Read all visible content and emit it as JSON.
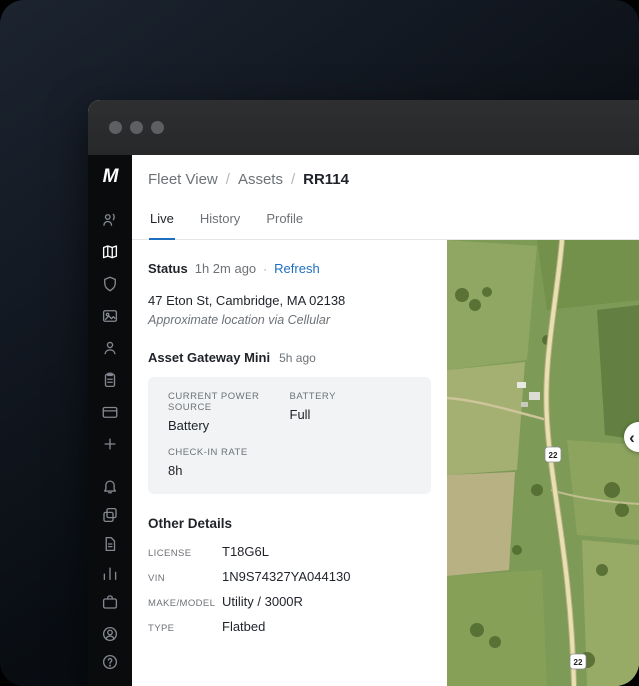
{
  "brand": {
    "logo": "M"
  },
  "colors": {
    "accent": "#1e6fc0",
    "sidebar_bg": "#0a0b0d",
    "titlebar_bg": "#2a2b2d",
    "card_bg": "#f1f3f4"
  },
  "breadcrumb": {
    "items": [
      "Fleet View",
      "Assets",
      "RR114"
    ],
    "separator": "/"
  },
  "tabs": [
    {
      "label": "Live",
      "active": true
    },
    {
      "label": "History",
      "active": false
    },
    {
      "label": "Profile",
      "active": false
    }
  ],
  "status": {
    "label": "Status",
    "updated": "1h 2m ago",
    "separator": "·",
    "refresh": "Refresh",
    "address": "47 Eton St, Cambridge, MA 02138",
    "note": "Approximate location via Cellular"
  },
  "gateway": {
    "title": "Asset Gateway Mini",
    "updated": "5h ago",
    "fields": [
      {
        "label": "CURRENT POWER SOURCE",
        "value": "Battery"
      },
      {
        "label": "BATTERY",
        "value": "Full"
      },
      {
        "label": "CHECK-IN RATE",
        "value": "8h"
      }
    ]
  },
  "other_details": {
    "title": "Other Details",
    "rows": [
      {
        "label": "LICENSE",
        "value": "T18G6L"
      },
      {
        "label": "VIN",
        "value": "1N9S74327YA044130"
      },
      {
        "label": "MAKE/MODEL",
        "value": "Utility / 3000R"
      },
      {
        "label": "TYPE",
        "value": "Flatbed"
      }
    ]
  },
  "map": {
    "type": "satellite",
    "route_markers": [
      "22",
      "22"
    ]
  },
  "sidebar": {
    "icons": [
      "follow-asset",
      "map",
      "shield",
      "gallery",
      "user",
      "clipboard",
      "card",
      "plus",
      "bell",
      "layers",
      "document",
      "chart",
      "briefcase"
    ],
    "bottom_icons": [
      "account",
      "help"
    ],
    "active_icon": "map"
  }
}
